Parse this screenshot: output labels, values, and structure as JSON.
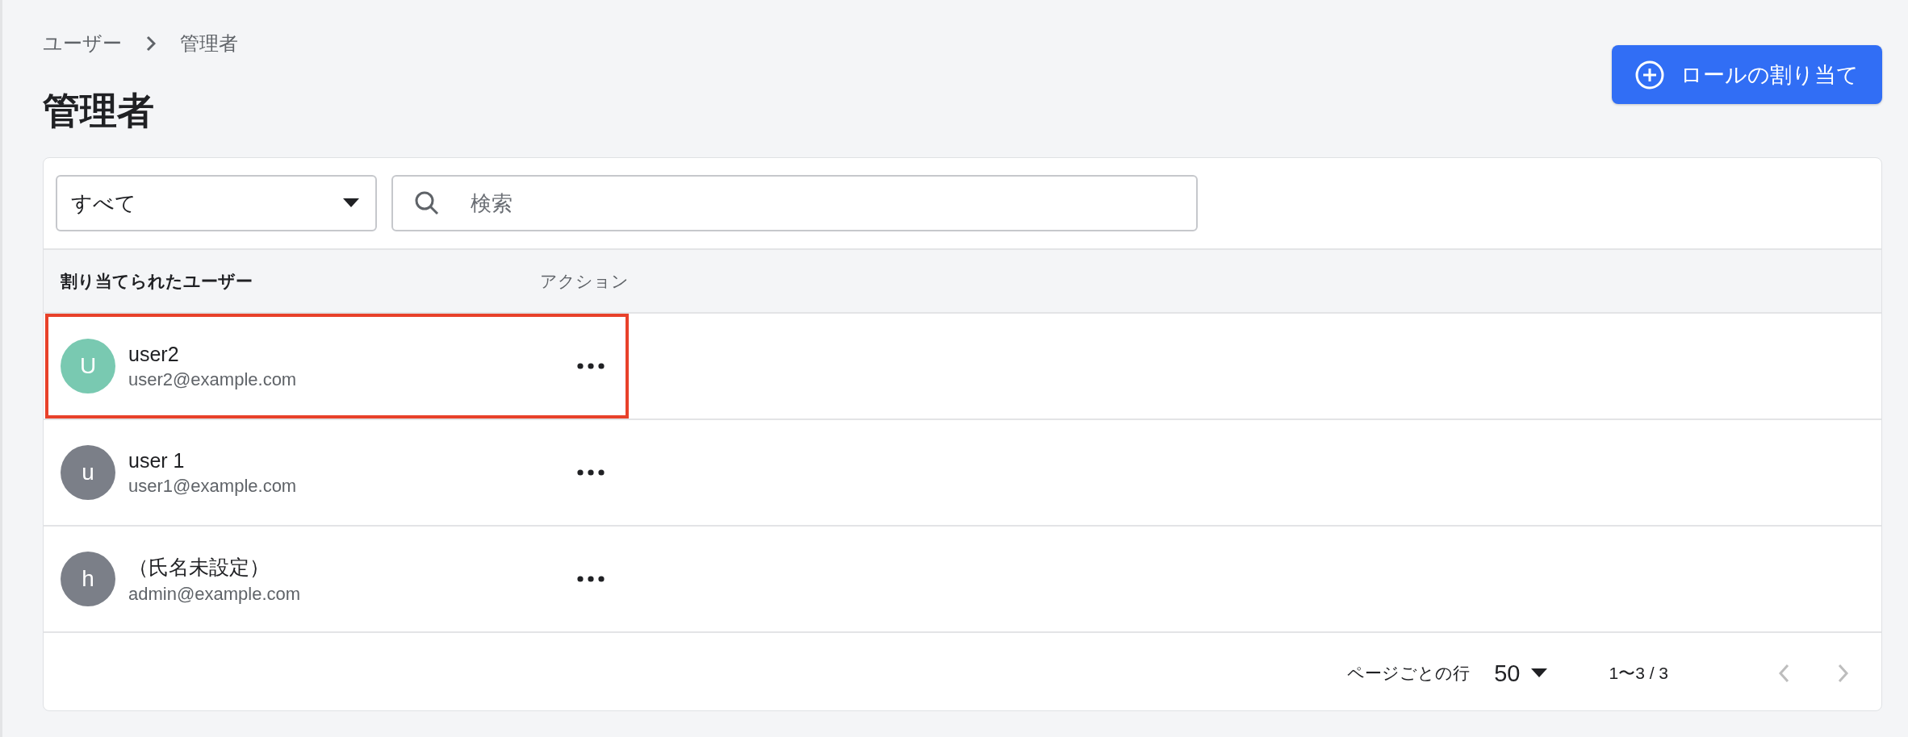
{
  "breadcrumb": [
    {
      "label": "ユーザー"
    },
    {
      "label": "管理者"
    }
  ],
  "title": "管理者",
  "assign_button": {
    "label": "ロールの割り当て"
  },
  "filter": {
    "value": "すべて"
  },
  "search": {
    "placeholder": "検索"
  },
  "table": {
    "columns": [
      "割り当てられたユーザー",
      "アクション"
    ],
    "rows": [
      {
        "avatar": "U",
        "color": "#79c9b1",
        "name": "user2",
        "email": "user2@example.com",
        "highlighted": true
      },
      {
        "avatar": "u",
        "color": "#7b7f88",
        "name": "user 1",
        "email": "user1@example.com",
        "highlighted": false
      },
      {
        "avatar": "h",
        "color": "#7b7f88",
        "name": "（氏名未設定）",
        "email": "admin@example.com",
        "highlighted": false
      }
    ]
  },
  "pagination": {
    "rows_label": "ページごとの行",
    "rows_per_page": "50",
    "range": "1〜3 / 3",
    "prev_disabled": true,
    "next_disabled": true
  }
}
